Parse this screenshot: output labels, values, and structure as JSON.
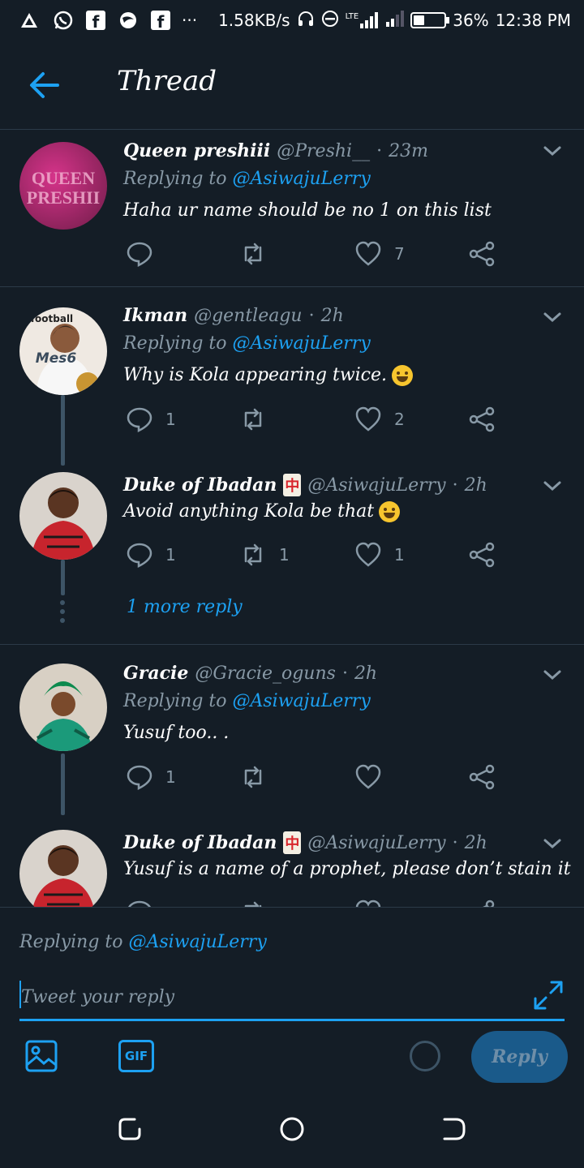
{
  "status_bar": {
    "network_speed": "1.58KB/s",
    "network_type": "LTE",
    "battery": "36%",
    "battery_level": 0.36,
    "time": "12:38 PM",
    "overflow": "···"
  },
  "header": {
    "title": "Thread",
    "back_icon": "arrow-left-icon"
  },
  "tweets": [
    {
      "name": "Queen preshiii",
      "handle": "@Preshi__",
      "time": "23m",
      "replying_prefix": "Replying to",
      "replying_to": "@AsiwajuLerry",
      "text": "Haha ur name should be no 1 on this list",
      "replies": "",
      "retweets": "",
      "likes": "7",
      "avatar_colors": [
        "#c8267a",
        "#7a1d4f"
      ]
    },
    {
      "name": "Ikman",
      "handle": "@gentleagu",
      "time": "2h",
      "replying_prefix": "Replying to",
      "replying_to": "@AsiwajuLerry",
      "text": "Why is Kola appearing twice.",
      "replies": "1",
      "retweets": "",
      "likes": "2",
      "avatar_label": "Mes6",
      "avatar_top_text": "football"
    },
    {
      "name": "Duke of Ibadan",
      "badge": "中",
      "handle": "@AsiwajuLerry",
      "time": "2h",
      "text": "Avoid anything Kola be that",
      "replies": "1",
      "retweets": "1",
      "likes": "1"
    },
    {
      "name": "Gracie",
      "handle": "@Gracie_oguns",
      "time": "2h",
      "replying_prefix": "Replying to",
      "replying_to": "@AsiwajuLerry",
      "text": "Yusuf too.. .",
      "replies": "1",
      "retweets": "",
      "likes": ""
    },
    {
      "name": "Duke of Ibadan",
      "badge": "中",
      "handle": "@AsiwajuLerry",
      "time": "2h",
      "text": "Yusuf is a name of a prophet, please don’t stain it"
    }
  ],
  "more_reply": "1 more reply",
  "compose": {
    "replying_prefix": "Replying to",
    "replying_to": "@AsiwajuLerry",
    "placeholder": "Tweet your reply",
    "gif_label": "GIF",
    "reply_button": "Reply"
  },
  "colors": {
    "background": "#141d26",
    "accent": "#1da1f2",
    "muted": "#8899a6",
    "divider": "#2b3a48"
  }
}
